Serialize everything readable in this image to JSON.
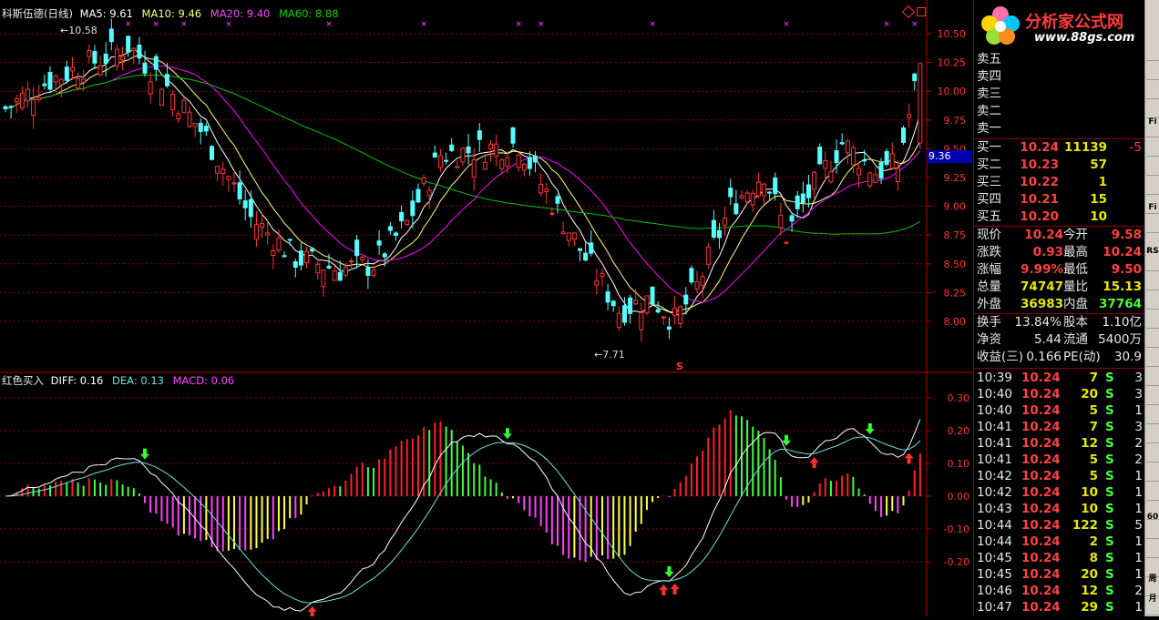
{
  "header": {
    "stock_name": "科斯伍德(日线)",
    "ma5": "MA5: 9.61",
    "ma10": "MA10: 9.46",
    "ma20": "MA20: 9.40",
    "ma60": "MA60: 8.88"
  },
  "macd_header": {
    "name": "红色买入",
    "diff": "DIFF: 0.16",
    "dea": "DEA: 0.13",
    "macd": "MACD: 0.06"
  },
  "annotations": {
    "high": "10.58",
    "low": "7.71",
    "current": "9.36",
    "s_marker": "S"
  },
  "price_axis": [
    "10.50",
    "10.25",
    "10.00",
    "9.75",
    "9.50",
    "9.25",
    "9.00",
    "8.75",
    "8.50",
    "8.25",
    "8.00"
  ],
  "macd_axis": [
    "0.30",
    "0.20",
    "0.10",
    "0.00",
    "-0.10",
    "-0.20"
  ],
  "logo": {
    "title": "分析家公式网",
    "url": "www.88gs.com"
  },
  "sell_orders": [
    {
      "label": "卖五"
    },
    {
      "label": "卖四"
    },
    {
      "label": "卖三"
    },
    {
      "label": "卖二"
    },
    {
      "label": "卖一"
    }
  ],
  "buy_orders": [
    {
      "label": "买一",
      "price": "10.24",
      "vol": "11139",
      "chg": "-5"
    },
    {
      "label": "买二",
      "price": "10.23",
      "vol": "57",
      "chg": ""
    },
    {
      "label": "买三",
      "price": "10.22",
      "vol": "1",
      "chg": ""
    },
    {
      "label": "买四",
      "price": "10.21",
      "vol": "15",
      "chg": ""
    },
    {
      "label": "买五",
      "price": "10.20",
      "vol": "10",
      "chg": ""
    }
  ],
  "quote": [
    {
      "l1": "现价",
      "v1": "10.24",
      "l2": "今开",
      "v2": "9.58"
    },
    {
      "l1": "涨跌",
      "v1": "0.93",
      "l2": "最高",
      "v2": "10.24"
    },
    {
      "l1": "涨幅",
      "v1": "9.99%",
      "l2": "最低",
      "v2": "9.50"
    },
    {
      "l1": "总量",
      "v1": "74747",
      "l2": "量比",
      "v2": "15.13"
    },
    {
      "l1": "外盘",
      "v1": "36983",
      "l2": "内盘",
      "v2": "37764"
    }
  ],
  "fundamentals": [
    {
      "l1": "换手",
      "v1": "13.84%",
      "l2": "股本",
      "v2": "1.10亿"
    },
    {
      "l1": "净资",
      "v1": "5.44",
      "l2": "流通",
      "v2": "5400万"
    },
    {
      "l1": "收益(三)",
      "v1": "0.166",
      "l2": "PE(动)",
      "v2": "30.9"
    }
  ],
  "ticks": [
    {
      "t": "10:39",
      "p": "10.24",
      "v": "7",
      "s": "S",
      "n": "3"
    },
    {
      "t": "10:40",
      "p": "10.24",
      "v": "20",
      "s": "S",
      "n": "3"
    },
    {
      "t": "10:40",
      "p": "10.24",
      "v": "5",
      "s": "S",
      "n": "1"
    },
    {
      "t": "10:41",
      "p": "10.24",
      "v": "7",
      "s": "S",
      "n": "3"
    },
    {
      "t": "10:41",
      "p": "10.24",
      "v": "12",
      "s": "S",
      "n": "2"
    },
    {
      "t": "10:41",
      "p": "10.24",
      "v": "5",
      "s": "S",
      "n": "2"
    },
    {
      "t": "10:42",
      "p": "10.24",
      "v": "5",
      "s": "S",
      "n": "1"
    },
    {
      "t": "10:42",
      "p": "10.24",
      "v": "10",
      "s": "S",
      "n": "1"
    },
    {
      "t": "10:43",
      "p": "10.24",
      "v": "10",
      "s": "S",
      "n": "1"
    },
    {
      "t": "10:44",
      "p": "10.24",
      "v": "122",
      "s": "S",
      "n": "5"
    },
    {
      "t": "10:44",
      "p": "10.24",
      "v": "2",
      "s": "S",
      "n": "1"
    },
    {
      "t": "10:45",
      "p": "10.24",
      "v": "8",
      "s": "S",
      "n": "1"
    },
    {
      "t": "10:45",
      "p": "10.24",
      "v": "20",
      "s": "S",
      "n": "1"
    },
    {
      "t": "10:46",
      "p": "10.24",
      "v": "12",
      "s": "S",
      "n": "2"
    },
    {
      "t": "10:47",
      "p": "10.24",
      "v": "29",
      "s": "S",
      "n": "1"
    }
  ],
  "toolbar": [
    "RS",
    "Fi",
    "Fi",
    "60",
    "周",
    "月"
  ],
  "colors": {
    "up": "#ff3232",
    "down": "#54ffff",
    "ma5": "#ffffff",
    "ma10": "#ffff80",
    "ma20": "#ff00ff",
    "ma60": "#00c000",
    "grid": "#8b0000"
  }
}
